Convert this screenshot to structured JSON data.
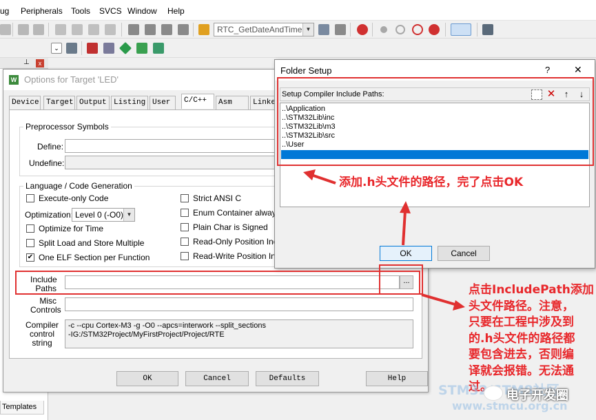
{
  "menu": [
    "ug",
    "Peripherals",
    "Tools",
    "SVCS",
    "Window",
    "Help"
  ],
  "toolbar": {
    "target_combo": "RTC_GetDateAndTime"
  },
  "sidebar": {
    "templates_tab": "Templates"
  },
  "options_dialog": {
    "title": "Options for Target 'LED'",
    "tabs": [
      "Device",
      "Target",
      "Output",
      "Listing",
      "User",
      "C/C++",
      "Asm",
      "Linker"
    ],
    "preprocessor": {
      "group": "Preprocessor Symbols",
      "define_label": "Define:",
      "undefine_label": "Undefine:"
    },
    "language": {
      "group": "Language / Code Generation",
      "execute_only": "Execute-only Code",
      "optimization_label": "Optimization:",
      "optimization_value": "Level 0 (-O0)",
      "optimize_time": "Optimize for Time",
      "split_load": "Split Load and Store Multiple",
      "one_elf": "One ELF Section per Function",
      "strict_ansi": "Strict ANSI C",
      "enum_container": "Enum Container always in",
      "plain_char": "Plain Char is Signed",
      "ro_position": "Read-Only Position Indepe",
      "rw_position": "Read-Write Position Indep"
    },
    "include_label": [
      "Include",
      "Paths"
    ],
    "include_button": "...",
    "misc_label": [
      "Misc",
      "Controls"
    ],
    "compiler_label": [
      "Compiler",
      "control",
      "string"
    ],
    "compiler_lines": [
      "-c --cpu Cortex-M3 -g -O0 --apcs=interwork --split_sections",
      "-IG:/STM32Project/MyFirstProject/Project/RTE"
    ],
    "buttons": {
      "ok": "OK",
      "cancel": "Cancel",
      "defaults": "Defaults",
      "help": "Help"
    }
  },
  "folder_setup": {
    "title": "Folder Setup",
    "help": "?",
    "close": "✕",
    "header": "Setup Compiler Include Paths:",
    "paths": [
      "..\\Application",
      "..\\STM32Lib\\inc",
      "..\\STM32Lib\\m3",
      "..\\STM32Lib\\src",
      "..\\User"
    ],
    "ok": "OK",
    "cancel": "Cancel"
  },
  "annotations": {
    "top": "添加.h头文件的路径，完了点击OK",
    "right": [
      "点击IncludePath添加",
      "头文件路径。注意，",
      "只要在工程中涉及到",
      "的.h头文件的路径都",
      "要包含进去，否则编",
      "译就会报错。无法通",
      "过。"
    ]
  },
  "watermark": {
    "brand": "电子开发圈",
    "site": "STM32/STM8社区",
    "url": "www.stmcu.org.cn"
  },
  "colors": {
    "highlight": "#0078d7",
    "annotation": "#e8272b",
    "box": "#e03030"
  }
}
